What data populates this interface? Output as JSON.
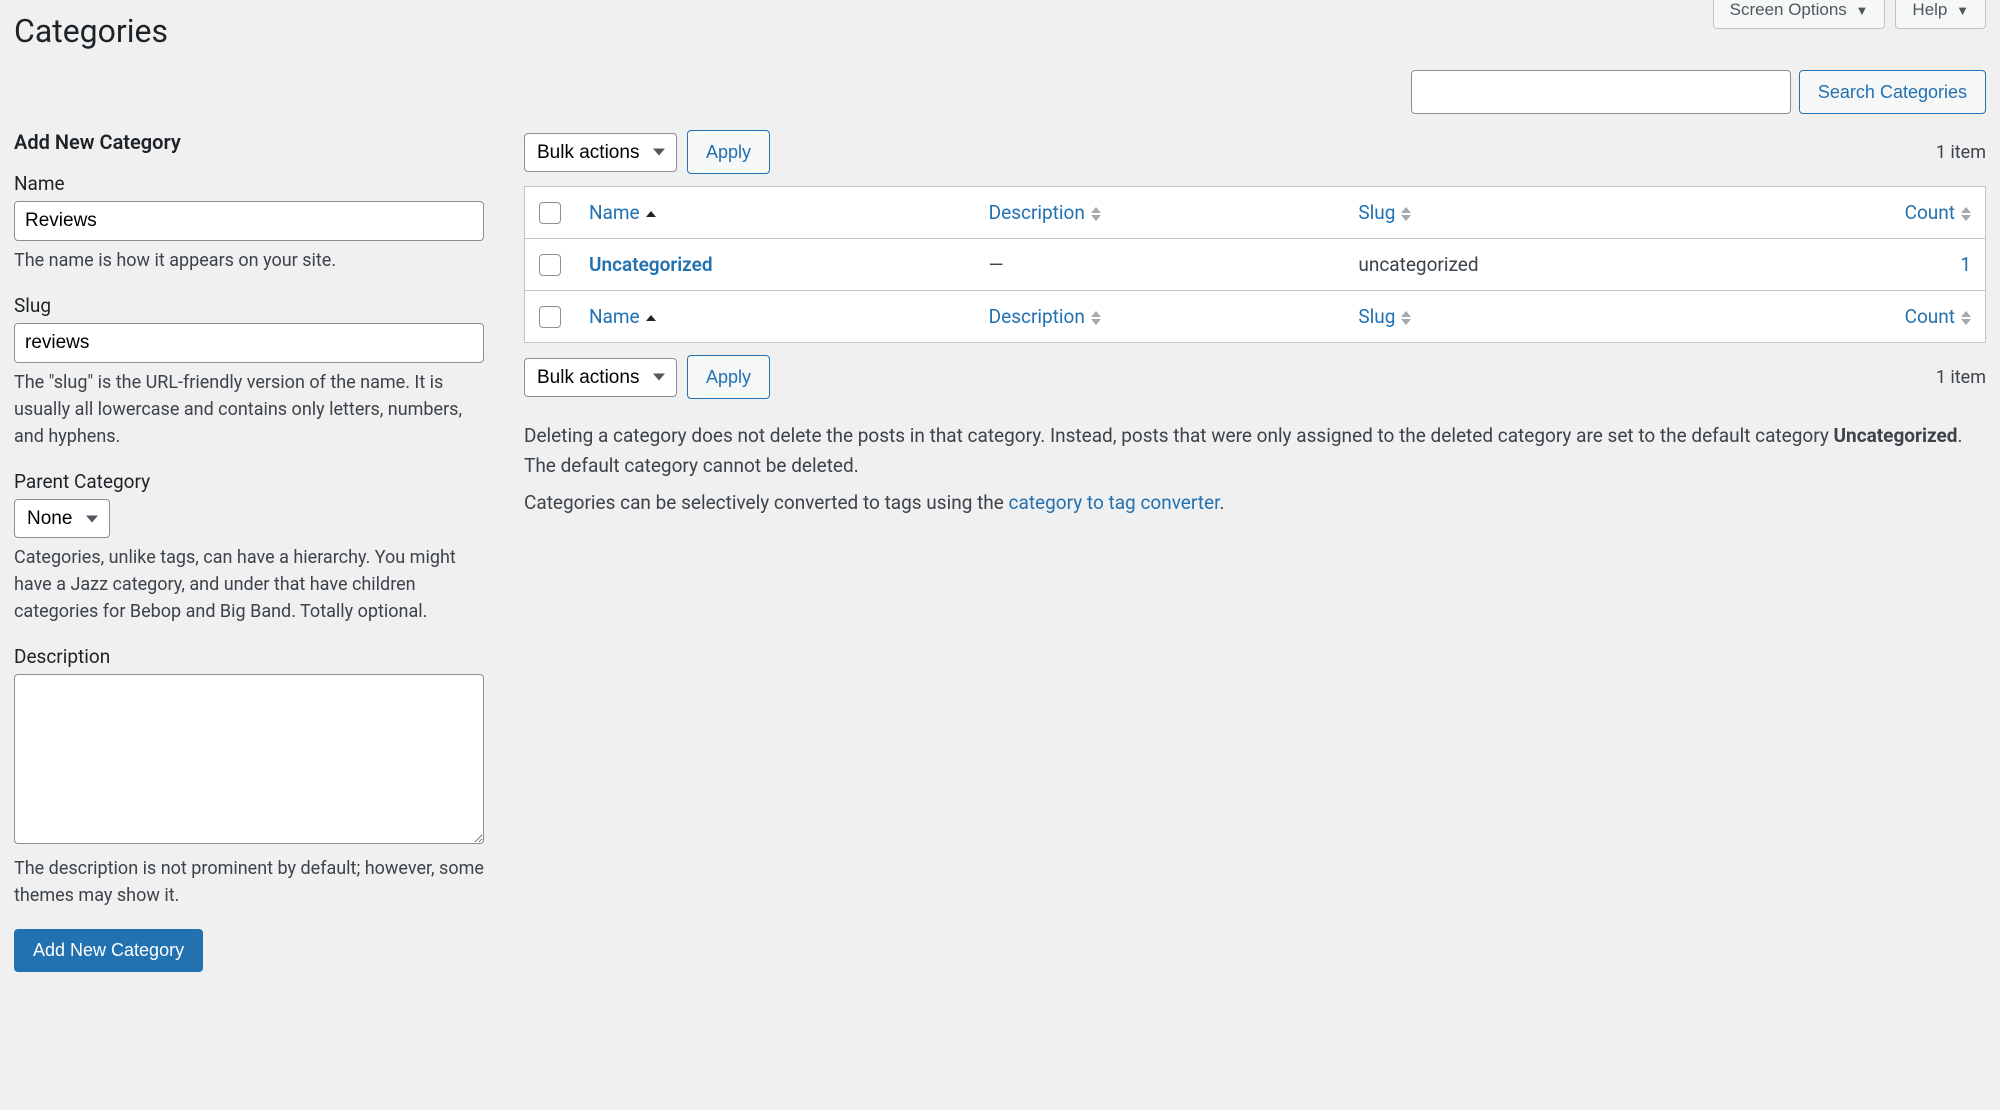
{
  "topButtons": {
    "screenOptions": "Screen Options",
    "help": "Help"
  },
  "pageTitle": "Categories",
  "search": {
    "value": "",
    "button": "Search Categories"
  },
  "form": {
    "title": "Add New Category",
    "name": {
      "label": "Name",
      "value": "Reviews",
      "help": "The name is how it appears on your site."
    },
    "slug": {
      "label": "Slug",
      "value": "reviews",
      "help": "The \"slug\" is the URL-friendly version of the name. It is usually all lowercase and contains only letters, numbers, and hyphens."
    },
    "parent": {
      "label": "Parent Category",
      "value": "None",
      "help": "Categories, unlike tags, can have a hierarchy. You might have a Jazz category, and under that have children categories for Bebop and Big Band. Totally optional."
    },
    "description": {
      "label": "Description",
      "value": "",
      "help": "The description is not prominent by default; however, some themes may show it."
    },
    "submit": "Add New Category"
  },
  "bulk": {
    "select": "Bulk actions",
    "apply": "Apply"
  },
  "itemCount": "1 item",
  "columns": {
    "name": "Name",
    "description": "Description",
    "slug": "Slug",
    "count": "Count"
  },
  "rows": [
    {
      "name": "Uncategorized",
      "description": "—",
      "slug": "uncategorized",
      "count": "1"
    }
  ],
  "notes": {
    "p1a": "Deleting a category does not delete the posts in that category. Instead, posts that were only assigned to the deleted category are set to the default category ",
    "p1b": "Uncategorized",
    "p1c": ". The default category cannot be deleted.",
    "p2a": "Categories can be selectively converted to tags using the ",
    "p2link": "category to tag converter",
    "p2b": "."
  }
}
